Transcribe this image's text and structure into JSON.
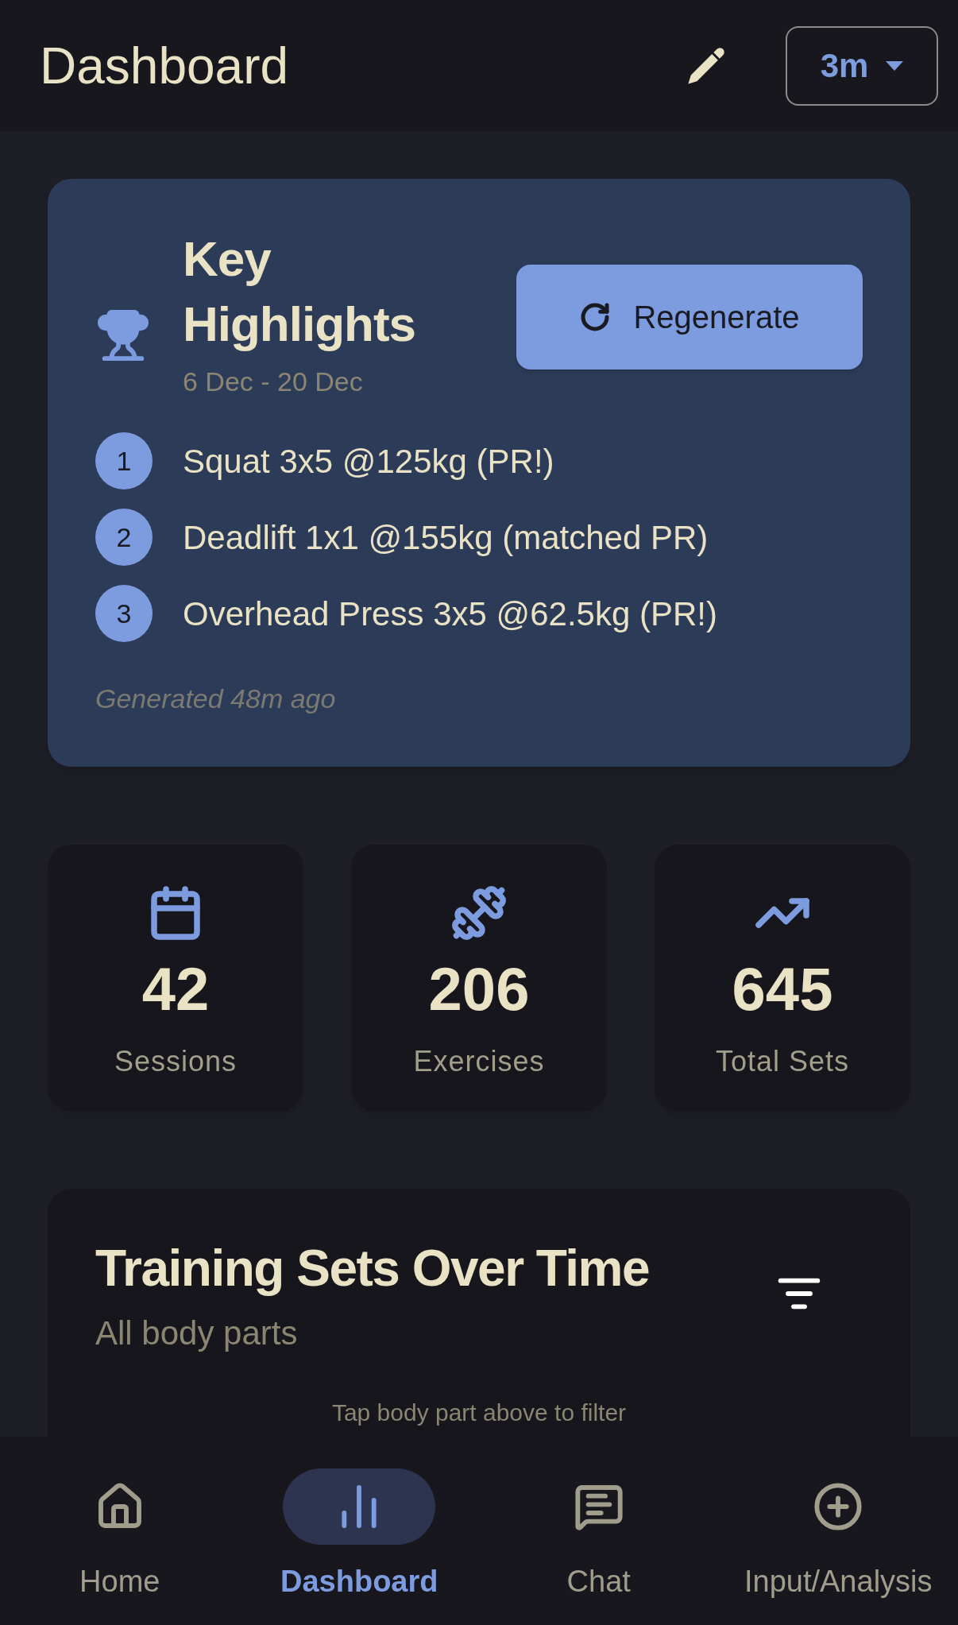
{
  "header": {
    "title": "Dashboard",
    "range": "3m"
  },
  "highlights": {
    "title": "Key Highlights",
    "button": "Regenerate",
    "dates": "6 Dec - 20 Dec",
    "items": [
      {
        "number": "1",
        "text": "Squat 3x5 @125kg (PR!)"
      },
      {
        "number": "2",
        "text": "Deadlift 1x1 @155kg (matched PR)"
      },
      {
        "number": "3",
        "text": "Overhead Press 3x5 @62.5kg (PR!)"
      }
    ],
    "footer": "Generated 48m ago"
  },
  "stats": [
    {
      "value": "42",
      "label": "Sessions"
    },
    {
      "value": "206",
      "label": "Exercises"
    },
    {
      "value": "645",
      "label": "Total Sets"
    }
  ],
  "training": {
    "title": "Training Sets Over Time",
    "subtitle": "All body parts",
    "hint": "Tap body part above to filter"
  },
  "nav": [
    {
      "label": "Home",
      "selected": false
    },
    {
      "label": "Dashboard",
      "selected": true
    },
    {
      "label": "Chat",
      "selected": false
    },
    {
      "label": "Input/Analysis",
      "selected": false
    }
  ]
}
